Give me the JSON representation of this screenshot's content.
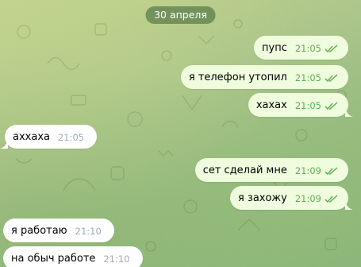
{
  "date_separator": "30 апреля",
  "messages": [
    {
      "direction": "out",
      "text": "пупс",
      "time": "21:05",
      "read": true
    },
    {
      "direction": "out",
      "text": "я телефон утопил",
      "time": "21:05",
      "read": true
    },
    {
      "direction": "out",
      "text": "хахах",
      "time": "21:05",
      "read": true
    },
    {
      "direction": "in",
      "text": "аххаха",
      "time": "21:05"
    },
    {
      "direction": "out",
      "text": "сет сделай мне",
      "time": "21:09",
      "read": true
    },
    {
      "direction": "out",
      "text": "я захожу",
      "time": "21:09",
      "read": true
    },
    {
      "direction": "in",
      "text": "я работаю",
      "time": "21:10"
    },
    {
      "direction": "in",
      "text": "на обыч работе",
      "time": "21:10"
    }
  ],
  "colors": {
    "outgoing_bubble": "#effdde",
    "incoming_bubble": "#ffffff",
    "read_check": "#5fae53",
    "incoming_time": "#a0acb6",
    "date_pill": "#60804e"
  },
  "icons": {
    "read_status": "double-check-icon"
  }
}
